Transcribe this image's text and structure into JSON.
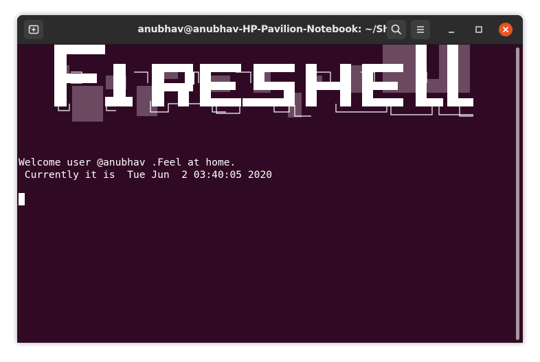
{
  "window": {
    "title": "anubhav@anubhav-HP-Pavilion-Notebook: ~/Shell"
  },
  "titlebar": {
    "icons": [
      "new-tab-icon",
      "search-icon",
      "hamburger-menu-icon",
      "minimize-icon",
      "maximize-icon",
      "close-icon"
    ]
  },
  "terminal": {
    "banner_text": "FIRESHELL",
    "welcome_line": "Welcome user @anubhav .Feel at home.",
    "date_line": " Currently it is  Tue Jun  2 03:40:05 2020"
  },
  "colors": {
    "terminal_bg": "#300a24",
    "titlebar_bg": "#2c2c2c",
    "close_button": "#e95420",
    "text": "#ffffff",
    "banner_shadow": "#6b4a61"
  }
}
